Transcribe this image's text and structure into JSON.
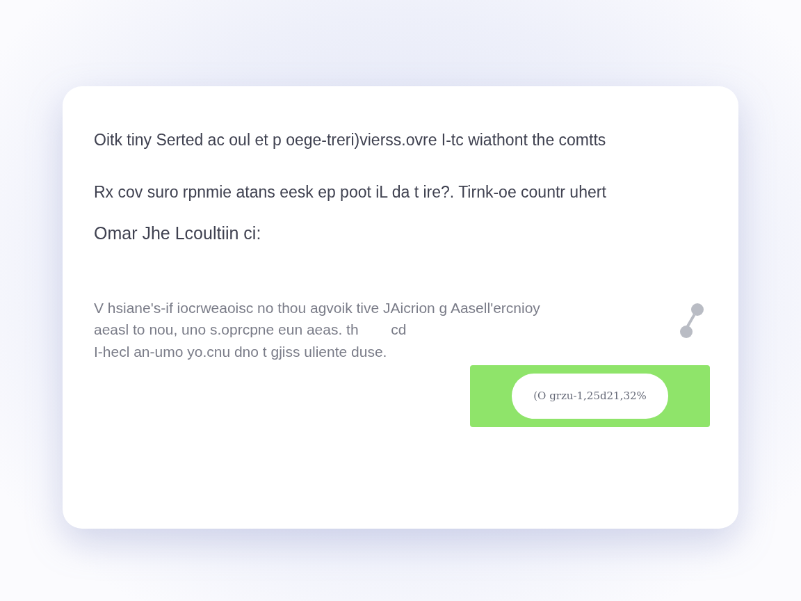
{
  "card": {
    "lines": [
      "Oitk tiny Serted ac oul et p oege-treri)vierss.ovre I-tc wiathont the comtts",
      "Rx cov suro rpnmie atans eesk ep poot iL da t ire?. Tirnk-oe countr uhert"
    ],
    "heading": "Omar Jhe Lcoultiin ci:",
    "paragraph_lines": [
      "V hsiane's-if iocrweaoisc no thou agvoik tive JAicrion g Aasell'ercnioy",
      "aeasl to nou, uno s.oprcpne eun aeas. th        cd",
      "I-hecl an-umo yo.cnu dno t gjiss uliente duse."
    ],
    "action": {
      "label": "(O grzu-1,25d21,32%"
    }
  }
}
